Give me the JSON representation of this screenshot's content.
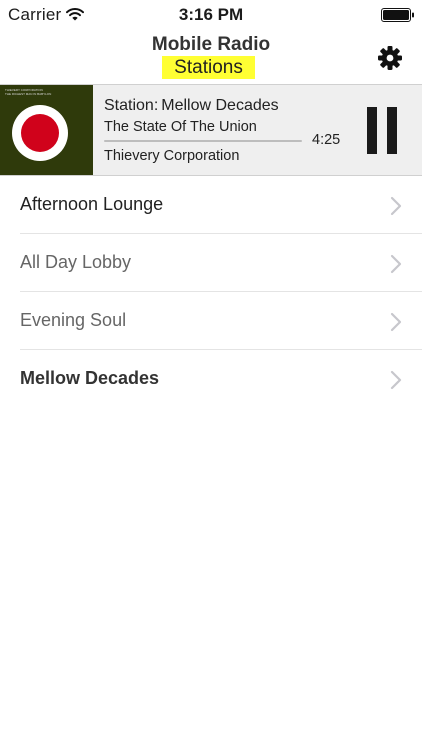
{
  "status_bar": {
    "carrier": "Carrier",
    "time": "3:16 PM",
    "wifi_icon": "wifi-icon",
    "battery_icon": "battery-full-icon"
  },
  "nav": {
    "title": "Mobile Radio",
    "subtitle": "Stations",
    "subtitle_highlight_color": "#ffff33",
    "settings_icon": "gear-icon"
  },
  "now_playing": {
    "station_label": "Station:",
    "station_name": "Mellow Decades",
    "track_title": "The State Of The Union",
    "artist": "Thievery Corporation",
    "time_remaining": "4:25",
    "progress_percent": 0,
    "album_art_text": [
      "Thievery Corporation",
      "The Richest Man In Babylon"
    ],
    "album_art_colors": {
      "background": "#2f3a0b",
      "ring": "#ffffff",
      "center": "#d0021b"
    },
    "control_icon": "pause-icon"
  },
  "stations": [
    {
      "name": "Afternoon Lounge",
      "state": "active"
    },
    {
      "name": "All Day Lobby",
      "state": "normal"
    },
    {
      "name": "Evening Soul",
      "state": "normal"
    },
    {
      "name": "Mellow Decades",
      "state": "selected"
    }
  ],
  "row_chevron_icon": "chevron-right-icon"
}
